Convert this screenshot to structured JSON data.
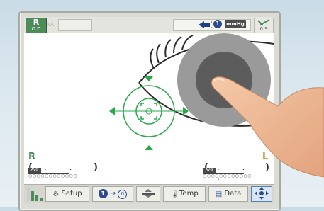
{
  "header": {
    "eye_side": "R",
    "eye_sub": "O D",
    "na_text": "NA",
    "status_number": "1",
    "unit": "mmHg",
    "mode_sub": "0 S"
  },
  "view": {
    "right_label": "R",
    "left_label": "L",
    "right_readout": {
      "open": "(",
      "dots": ". . .",
      "close": ")"
    },
    "left_readout": {
      "open": "(",
      "dots": ". . .",
      "close": ")"
    },
    "avg_label": "AVG",
    "avg_circles": "○○○○○○○○○○○○"
  },
  "toolbar": {
    "setup_label": "Setup",
    "temp_label": "Temp",
    "data_label": "Data",
    "switch_from": "1",
    "switch_to": "0"
  },
  "colors": {
    "accent_green": "#4e8b5a",
    "guide_green": "#2aa84a",
    "left_orange": "#c8953c",
    "iris_grey": "#9a9a9a",
    "pupil_dark": "#5c5c5c"
  }
}
